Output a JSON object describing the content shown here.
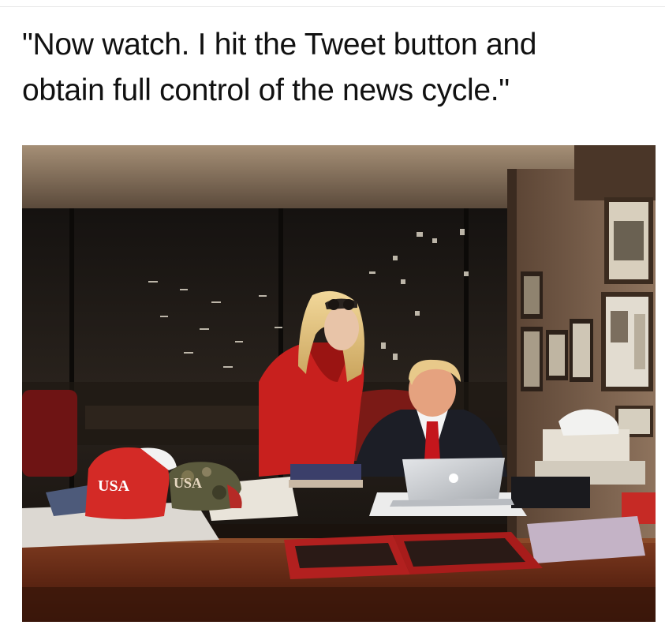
{
  "caption": {
    "line1": "\"Now watch. I hit the Tweet button and",
    "line2": "obtain full control of the news cycle.\""
  },
  "photo": {
    "cap_red_text": "USA",
    "cap_camo_text": "USA"
  },
  "colors": {
    "caption_text": "#111111",
    "jacket_red": "#c8201e",
    "desk_wood": "#6e2a16",
    "background": "#ffffff"
  }
}
